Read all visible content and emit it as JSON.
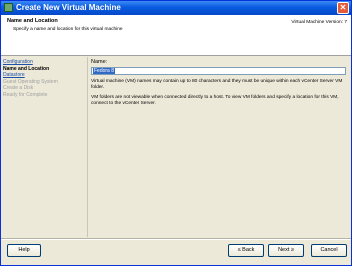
{
  "window": {
    "title": "Create New Virtual Machine",
    "close_glyph": "✕"
  },
  "header": {
    "title": "Name and Location",
    "subtitle": "Specify a name and location for this virtual machine",
    "version": "Virtual Machine Version: 7"
  },
  "nav": {
    "items": [
      {
        "label": "Configuration",
        "state": "link"
      },
      {
        "label": "Name and Location",
        "state": "current"
      },
      {
        "label": "Datastore",
        "state": "link"
      },
      {
        "label": "Guest Operating System",
        "state": "disabled"
      },
      {
        "label": "Create a Disk",
        "state": "disabled"
      },
      {
        "label": "Ready for Complete",
        "state": "disabled"
      }
    ]
  },
  "main": {
    "name_label": "Name:",
    "name_value": "Fedora 8",
    "help_text_1": "Virtual machine (VM) names may contain up to 80 characters and they must be unique within each vCenter Server VM folder.",
    "help_text_2": "VM folders are not viewable when connected directly to a host. To view VM folders and specify a location for this VM, connect to the vCenter Server."
  },
  "footer": {
    "help_label": "Help",
    "back_label": "≤ Back",
    "next_label": "Next ≥",
    "cancel_label": "Cancel"
  },
  "colors": {
    "titlebar": "#0a5ae0",
    "link": "#1c4fa8",
    "selection": "#316ac5",
    "dialog_bg": "#ece9d8"
  }
}
